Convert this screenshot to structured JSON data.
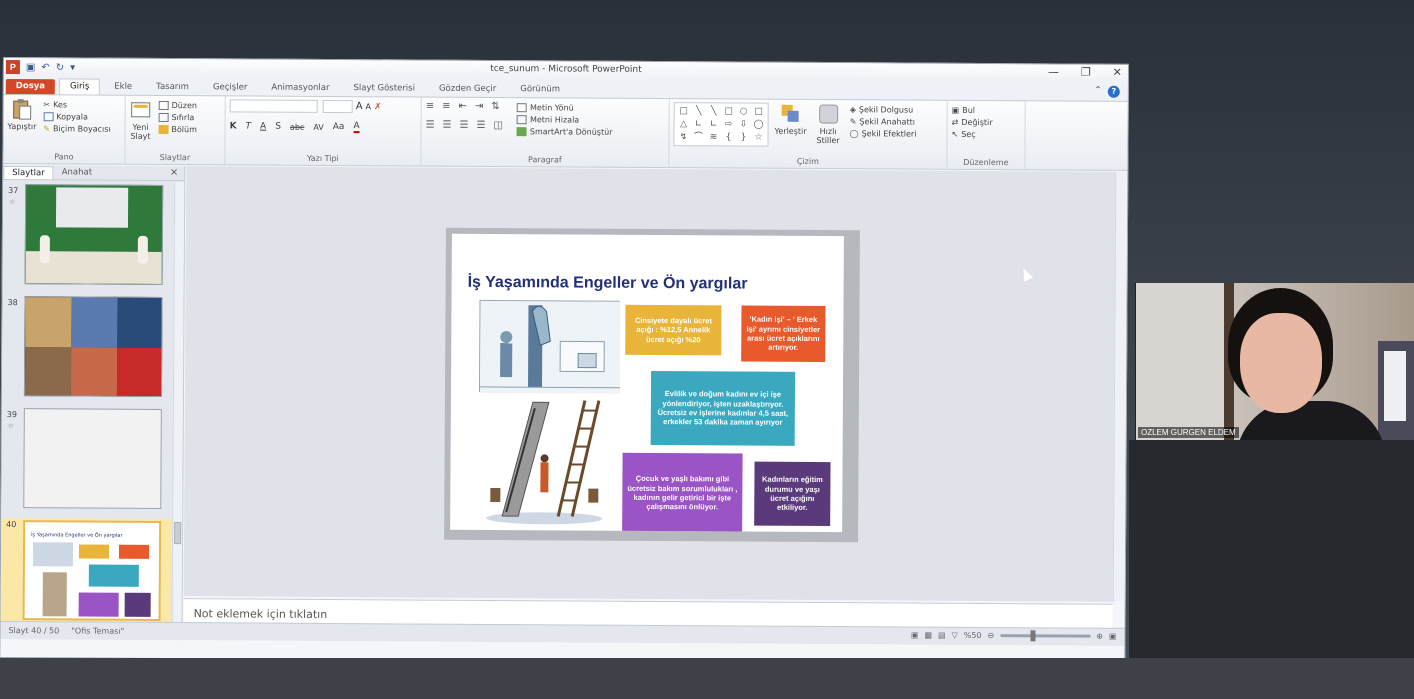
{
  "window": {
    "title": "tce_sunum  -  Microsoft PowerPoint",
    "logo": "P"
  },
  "tabs": [
    "Dosya",
    "Giriş",
    "Ekle",
    "Tasarım",
    "Geçişler",
    "Animasyonlar",
    "Slayt Gösterisi",
    "Gözden Geçir",
    "Görünüm"
  ],
  "ribbon": {
    "pano": {
      "label": "Pano",
      "paste": "Yapıştır",
      "cut": "Kes",
      "copy": "Kopyala",
      "format_painter": "Biçim Boyacısı"
    },
    "slaytlar": {
      "label": "Slaytlar",
      "new_slide": "Yeni\nSlayt",
      "layout": "Düzen",
      "reset": "Sıfırla",
      "section": "Bölüm"
    },
    "font": {
      "label": "Yazı Tipi",
      "bold": "K",
      "italic": "T",
      "underline": "A",
      "shadow": "S",
      "strike": "abc",
      "spacing": "AV",
      "case": "Aa",
      "color": "A",
      "grow": "A",
      "shrink": "A"
    },
    "paragraph": {
      "label": "Paragraf",
      "text_direction": "Metin Yönü",
      "align_text": "Metni Hizala",
      "smartart": "SmartArt'a Dönüştür"
    },
    "drawing": {
      "label": "Çizim",
      "arrange": "Yerleştir",
      "quick_styles": "Hızlı\nStiller",
      "shape_fill": "Şekil Dolgusu",
      "shape_outline": "Şekil Anahattı",
      "shape_effects": "Şekil Efektleri"
    },
    "editing": {
      "label": "Düzenleme",
      "find": "Bul",
      "replace": "Değiştir",
      "select": "Seç"
    }
  },
  "slides_pane": {
    "tab_slides": "Slaytlar",
    "tab_outline": "Anahat",
    "close": "×",
    "thumbnails": [
      {
        "number": "37"
      },
      {
        "number": "38"
      },
      {
        "number": "39"
      },
      {
        "number": "40"
      }
    ]
  },
  "slide": {
    "title": "İş Yaşamında Engeller ve Ön yargılar",
    "boxes": {
      "yellow": "Cinsiyete dayalı ücret açığı : %12,5 Annelik ücret açığı %20",
      "orange": "'Kadın işi' – ' Erkek işi' ayrımı cinsiyetler arası ücret açıklarını artırıyor.",
      "teal": "Evlilik ve doğum kadını ev içi işe yönlendiriyor, işten uzaklaştırıyor. Ücretsiz ev işlerine kadınlar 4,5 saat, erkekler 53 dakika zaman ayırıyor",
      "purple": "Çocuk ve yaşlı bakımı gibi ücretsiz bakım sorumlulukları , kadının gelir getirici bir işte çalışmasını önlüyor.",
      "dark": "Kadınların eğitim durumu ve yaşı ücret açığını etkiliyor."
    }
  },
  "thumb_40_title": "İş Yaşamında Engeller ve Ön yargılar",
  "notes": {
    "placeholder": "Not eklemek için tıklatın"
  },
  "status": {
    "slide_info": "Slayt 40 / 50",
    "theme": "\"Ofis Teması\"",
    "zoom": "%50"
  },
  "video": {
    "participant_name": "OZLEM GURGEN ELDEM"
  },
  "colors": {
    "file_tab": "#d24726",
    "title_blue": "#23307a",
    "box_yellow": "#e8b43a",
    "box_orange": "#e8592b",
    "box_teal": "#3aa9c0",
    "box_purple": "#9a54c6",
    "box_dark": "#5a3a7a"
  }
}
